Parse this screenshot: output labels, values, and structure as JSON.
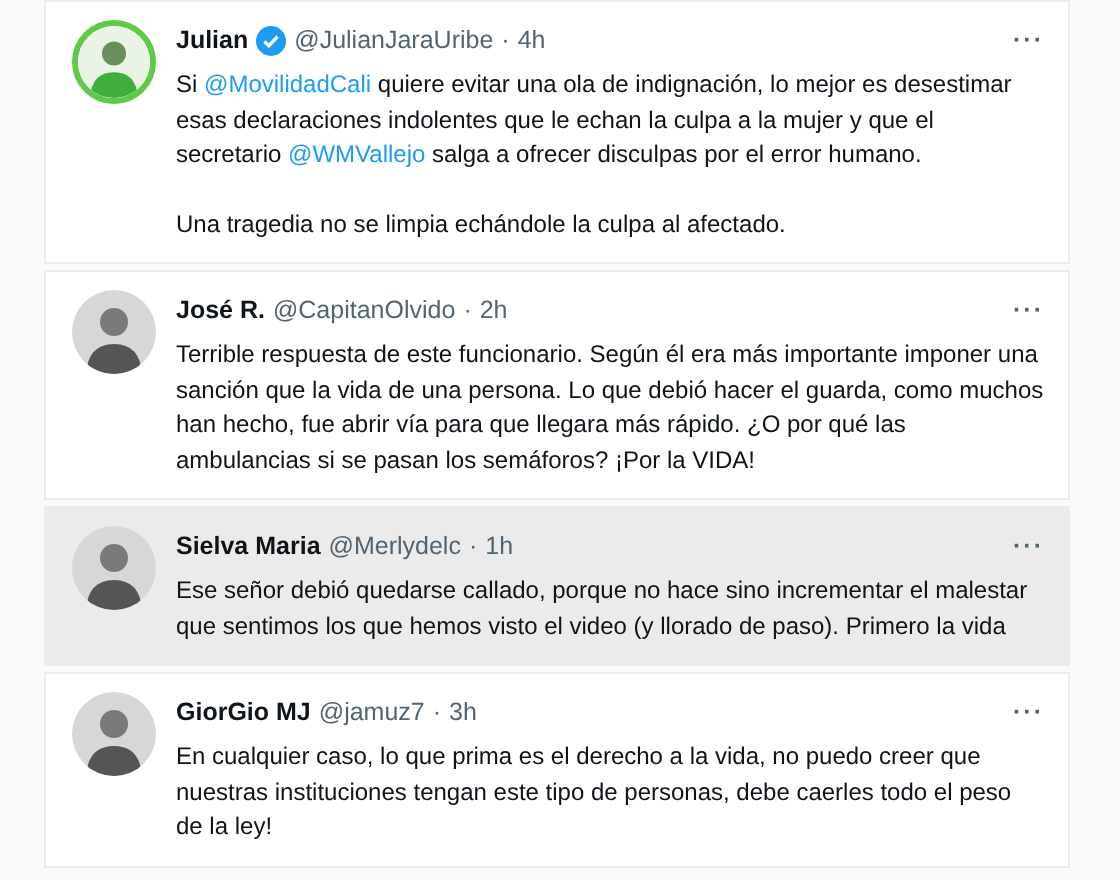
{
  "tweets": [
    {
      "name": "Julian",
      "verified": true,
      "highlighted": false,
      "ring": true,
      "handle": "@JulianJaraUribe",
      "time": "4h",
      "separator": "·",
      "more": "···",
      "paragraphs": [
        [
          {
            "kind": "plain",
            "text": "Si "
          },
          {
            "kind": "mention",
            "text": "@MovilidadCali"
          },
          {
            "kind": "plain",
            "text": " quiere evitar una ola de indignación, lo mejor es desestimar esas declaraciones indolentes que le echan la culpa a la mujer y que el secretario "
          },
          {
            "kind": "mention",
            "text": "@WMVallejo"
          },
          {
            "kind": "plain",
            "text": " salga a ofrecer disculpas por el error humano."
          }
        ],
        [
          {
            "kind": "plain",
            "text": "Una tragedia no se limpia echándole la culpa al afectado."
          }
        ]
      ]
    },
    {
      "name": "José R.",
      "verified": false,
      "highlighted": false,
      "ring": false,
      "handle": "@CapitanOlvido",
      "time": "2h",
      "separator": "·",
      "more": "···",
      "paragraphs": [
        [
          {
            "kind": "plain",
            "text": "Terrible respuesta de este funcionario. Según él era más importante imponer una sanción que la vida de una persona. Lo que debió hacer el guarda, como muchos han hecho, fue abrir vía para que llegara más rápido. ¿O por qué las ambulancias si se pasan los semáforos? ¡Por la VIDA!"
          }
        ]
      ]
    },
    {
      "name": "Sielva Maria",
      "verified": false,
      "highlighted": true,
      "ring": false,
      "handle": "@Merlydelc",
      "time": "1h",
      "separator": "·",
      "more": "···",
      "paragraphs": [
        [
          {
            "kind": "plain",
            "text": "Ese señor debió quedarse callado, porque no hace sino incrementar el malestar que sentimos los que hemos visto el video (y llorado de paso). Primero la vida"
          }
        ]
      ]
    },
    {
      "name": "GiorGio MJ",
      "verified": false,
      "highlighted": false,
      "ring": false,
      "handle": "@jamuz7",
      "time": "3h",
      "separator": "·",
      "more": "···",
      "paragraphs": [
        [
          {
            "kind": "plain",
            "text": "En cualquier caso, lo que prima es el derecho a la vida, no puedo creer que nuestras instituciones tengan este tipo de personas, debe caerles todo el peso de la ley!"
          }
        ]
      ]
    }
  ]
}
